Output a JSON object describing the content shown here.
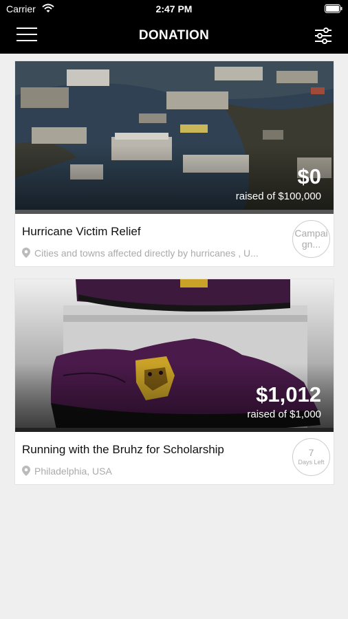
{
  "status_bar": {
    "carrier": "Carrier",
    "time": "2:47 PM"
  },
  "nav": {
    "title": "DONATION",
    "menu_icon": "hamburger-menu-icon",
    "filter_icon": "sliders-filter-icon"
  },
  "campaigns": [
    {
      "title": "Hurricane Victim Relief",
      "location": "Cities and towns affected directly by hurricanes , U...",
      "raised": "$0",
      "goal_text": "raised of $100,000",
      "progress": 0,
      "badge_line1": "Campai",
      "badge_line2": "gn..."
    },
    {
      "title": "Running with the Bruhz for Scholarship",
      "location": "Philadelphia, USA",
      "raised": "$1,012",
      "goal_text": "raised of $1,000",
      "progress": 1,
      "badge_number": "7",
      "badge_label": "Days Left"
    }
  ],
  "colors": {
    "bar_bg": "#000000",
    "page_bg": "#efefef",
    "shoe_purple": "#4a1a4a",
    "logo_gold": "#c9a227"
  }
}
